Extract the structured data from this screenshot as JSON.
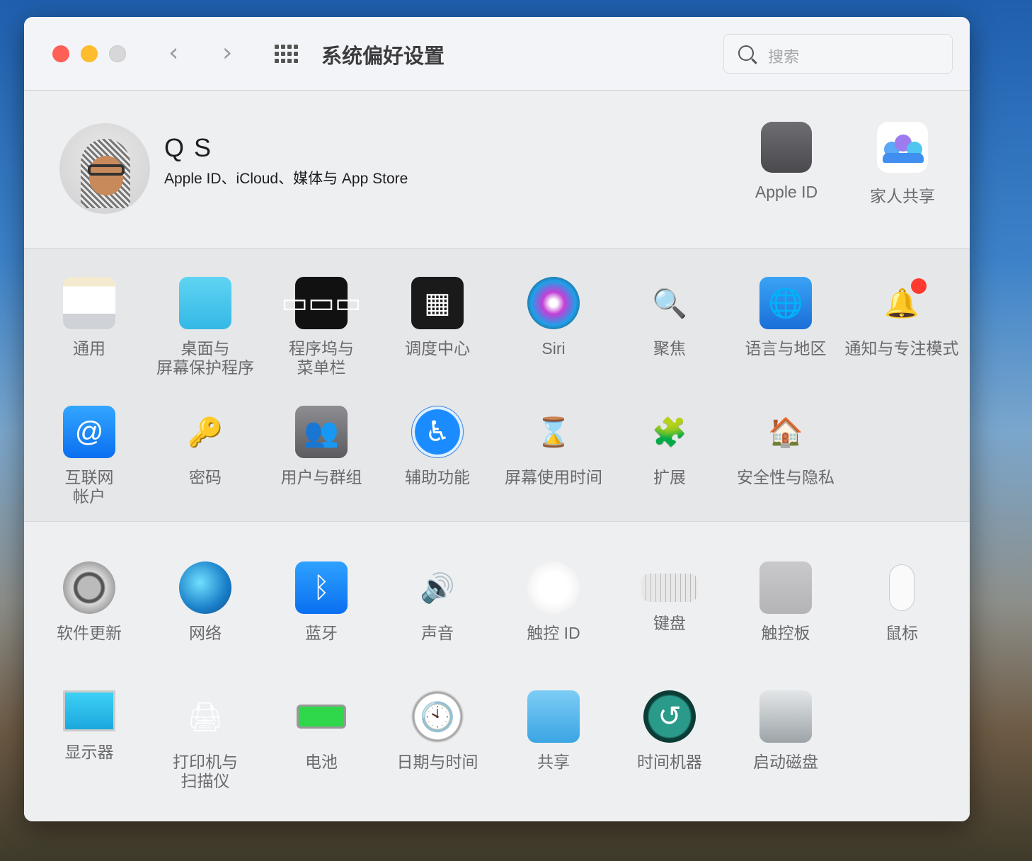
{
  "window": {
    "title": "系统偏好设置",
    "back": "‹",
    "forward": "›",
    "search_placeholder": "搜索"
  },
  "profile": {
    "name": "Q S",
    "subtitle": "Apple ID、iCloud、媒体与 App Store",
    "tiles": [
      {
        "label": "Apple ID",
        "icon": "apple-icon"
      },
      {
        "label": "家人共享",
        "icon": "family-icon"
      }
    ]
  },
  "section2": [
    {
      "label": "通用",
      "icon": "general-icon",
      "bg": "linear-gradient(#f3ead0 0 18%,#fff 18% 70%,#cfd3d8 70%)",
      "glyph": ""
    },
    {
      "label": "桌面与\n屏幕保护程序",
      "icon": "desktop-icon",
      "bg": "linear-gradient(#5fd4f2,#34b8e6)",
      "glyph": ""
    },
    {
      "label": "程序坞与\n菜单栏",
      "icon": "dock-icon",
      "bg": "#111",
      "glyph": "▭▭▭"
    },
    {
      "label": "调度中心",
      "icon": "mission-control-icon",
      "bg": "#1a1a1a",
      "glyph": "▦"
    },
    {
      "label": "Siri",
      "icon": "siri-icon",
      "bg": "radial-gradient(circle,#fff 0 10%,#c33fd6 30%,#1fa0e8 60%,#222 100%)",
      "glyph": ""
    },
    {
      "label": "聚焦",
      "icon": "spotlight-icon",
      "bg": "transparent",
      "glyph": "🔍"
    },
    {
      "label": "语言与地区",
      "icon": "globe-flag-icon",
      "bg": "linear-gradient(#3aa3f5,#1a6fd8)",
      "glyph": "🌐"
    },
    {
      "label": "通知与专注模式",
      "icon": "notification-bell-icon",
      "bg": "transparent",
      "glyph": "🔔",
      "badge": true
    },
    {
      "label": "互联网\n帐户",
      "icon": "at-icon",
      "bg": "linear-gradient(#33a6ff,#0a6ff0)",
      "glyph": "@"
    },
    {
      "label": "密码",
      "icon": "key-icon",
      "bg": "transparent",
      "glyph": "🔑"
    },
    {
      "label": "用户与群组",
      "icon": "users-icon",
      "bg": "linear-gradient(#8e8e92,#5c5c60)",
      "glyph": "👥"
    },
    {
      "label": "辅助功能",
      "icon": "accessibility-icon",
      "bg": "radial-gradient(circle,#1a8cff 60%,#e0f0ff 62% 68%,#1a6fd8 70%)",
      "glyph": "♿"
    },
    {
      "label": "屏幕使用时间",
      "icon": "hourglass-icon",
      "bg": "transparent",
      "glyph": "⌛"
    },
    {
      "label": "扩展",
      "icon": "puzzle-icon",
      "bg": "transparent",
      "glyph": "🧩"
    },
    {
      "label": "安全性与隐私",
      "icon": "house-lock-icon",
      "bg": "transparent",
      "glyph": "🏠"
    }
  ],
  "section3": [
    {
      "label": "软件更新",
      "icon": "gear-icon",
      "bg": "radial-gradient(circle,#bbb 30%,#555 34% 40%,#d8d8d8 44%,#666 100%)",
      "glyph": ""
    },
    {
      "label": "网络",
      "icon": "network-globe-icon",
      "bg": "radial-gradient(circle at 40% 40%,#6fe0ff,#1a7fc8 60%,#0c4a8a)",
      "glyph": ""
    },
    {
      "label": "蓝牙",
      "icon": "bluetooth-icon",
      "bg": "linear-gradient(#2ea2ff,#0a6ff0)",
      "glyph": "ᛒ"
    },
    {
      "label": "声音",
      "icon": "speaker-icon",
      "bg": "transparent",
      "glyph": "🔊"
    },
    {
      "label": "触控 ID",
      "icon": "fingerprint-icon",
      "bg": "radial-gradient(circle,#fff 0 40%,#f3f3f3 70%,#ddd)",
      "glyph": ""
    },
    {
      "label": "键盘",
      "icon": "keyboard-icon",
      "bg": "repeating-linear-gradient(90deg,#e8e8e8 0 6px,#bbb 6px 7px)",
      "glyph": ""
    },
    {
      "label": "触控板",
      "icon": "trackpad-icon",
      "bg": "linear-gradient(#c9c9cb,#b4b4b6)",
      "glyph": ""
    },
    {
      "label": "鼠标",
      "icon": "mouse-icon",
      "bg": "transparent",
      "glyph": ""
    },
    {
      "label": "显示器",
      "icon": "display-icon",
      "bg": "linear-gradient(#3ed0f5,#1aa8dd)",
      "glyph": ""
    },
    {
      "label": "打印机与\n扫描仪",
      "icon": "printer-icon",
      "bg": "transparent",
      "glyph": "🖨"
    },
    {
      "label": "电池",
      "icon": "battery-icon",
      "bg": "transparent",
      "glyph": ""
    },
    {
      "label": "日期与时间",
      "icon": "clock-calendar-icon",
      "bg": "radial-gradient(circle,#fff 60%,#999 64%,#ddd 70%)",
      "glyph": "🕙"
    },
    {
      "label": "共享",
      "icon": "shared-folder-icon",
      "bg": "linear-gradient(#7ccdf5,#3aa5e3)",
      "glyph": ""
    },
    {
      "label": "时间机器",
      "icon": "time-machine-icon",
      "bg": "radial-gradient(circle,#2a9a8a 55%,#0c3c36 60%)",
      "glyph": "↺"
    },
    {
      "label": "启动磁盘",
      "icon": "hard-disk-icon",
      "bg": "linear-gradient(#e3e6e8,#9da4a8)",
      "glyph": ""
    }
  ],
  "colors": {
    "close": "#fe5f57",
    "minimize": "#febc2e",
    "zoom": "#d7d7d9"
  }
}
